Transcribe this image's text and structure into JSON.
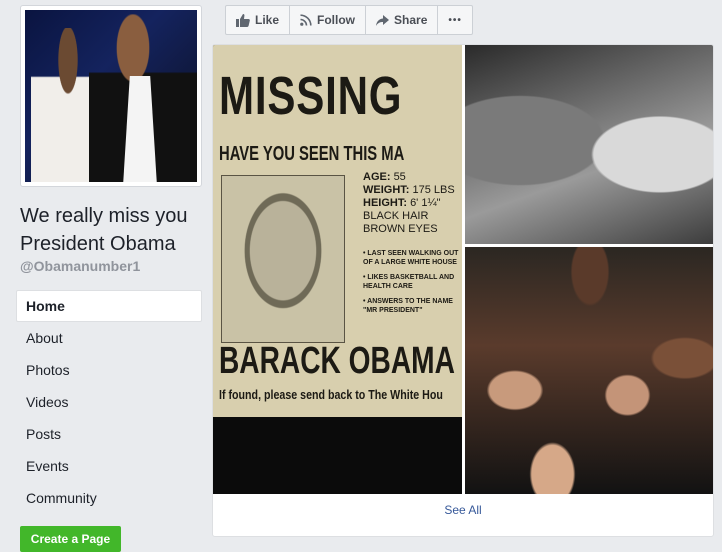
{
  "page": {
    "name": "We really miss you President Obama",
    "handle": "@Obamanumber1"
  },
  "nav": {
    "items": [
      {
        "label": "Home",
        "active": true
      },
      {
        "label": "About"
      },
      {
        "label": "Photos"
      },
      {
        "label": "Videos"
      },
      {
        "label": "Posts"
      },
      {
        "label": "Events"
      },
      {
        "label": "Community"
      }
    ]
  },
  "create_page_label": "Create a Page",
  "actions": {
    "like": {
      "label": "Like",
      "icon": "thumbs-up-icon"
    },
    "follow": {
      "label": "Follow",
      "icon": "rss-icon"
    },
    "share": {
      "label": "Share",
      "icon": "share-arrow-icon"
    },
    "more": {
      "label": "•••",
      "icon": "more-icon"
    }
  },
  "poster": {
    "title": "MISSING",
    "question": "HAVE YOU SEEN THIS MA",
    "age_label": "AGE:",
    "age_value": "55",
    "weight_label": "WEIGHT:",
    "weight_value": "175 LBS",
    "height_label": "HEIGHT:",
    "height_value": "6' 1¼\"",
    "hair": "BLACK HAIR",
    "eyes": "BROWN EYES",
    "bullet_1": "• LAST SEEN WALKING OUT OF A LARGE WHITE HOUSE",
    "bullet_2": "• LIKES BASKETBALL AND HEALTH CARE",
    "bullet_3": "• ANSWERS TO THE NAME \"MR PRESIDENT\"",
    "name": "BARACK OBAMA",
    "footer": "If found, please send back to The White Hou"
  },
  "see_all_label": "See All",
  "colors": {
    "background": "#e9ebee",
    "link": "#365899",
    "create_button": "#42b72a"
  }
}
